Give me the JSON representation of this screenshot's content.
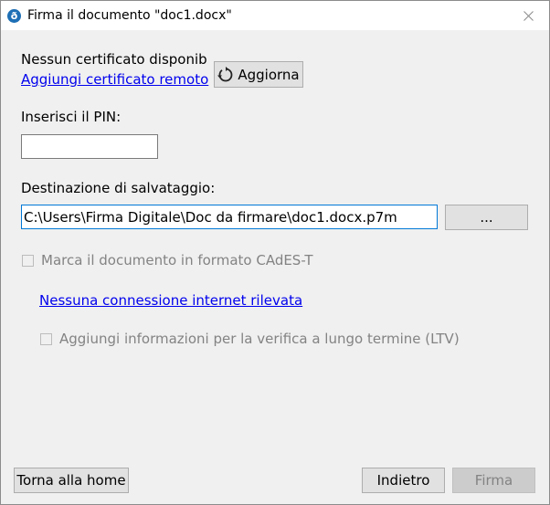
{
  "window": {
    "app_icon_glyph": "ð",
    "title": "Firma il documento \"doc1.docx\"",
    "close_icon": "close-icon"
  },
  "certificate": {
    "status_text": "Nessun certificato disponib",
    "add_remote_link": "Aggiungi certificato remoto",
    "refresh_label": "Aggiorna",
    "refresh_icon": "refresh-icon"
  },
  "pin": {
    "label": "Inserisci il PIN:",
    "value": ""
  },
  "destination": {
    "label": "Destinazione di salvataggio:",
    "path_value": "C:\\Users\\Firma Digitale\\Doc da firmare\\doc1.docx.p7m",
    "browse_label": "..."
  },
  "options": {
    "cades_t_label": "Marca il documento in formato CAdES-T",
    "cades_t_checked": false,
    "no_internet_link": "Nessuna connessione internet rilevata",
    "ltv_label": "Aggiungi informazioni per la verifica a lungo termine (LTV)",
    "ltv_checked": false
  },
  "footer": {
    "home_label": "Torna alla home",
    "back_label": "Indietro",
    "sign_label": "Firma"
  },
  "colors": {
    "app_icon": "#1e6fb5",
    "link": "#0000ee",
    "focus_border": "#0078d7",
    "dialog_bg": "#f0f0f0"
  }
}
